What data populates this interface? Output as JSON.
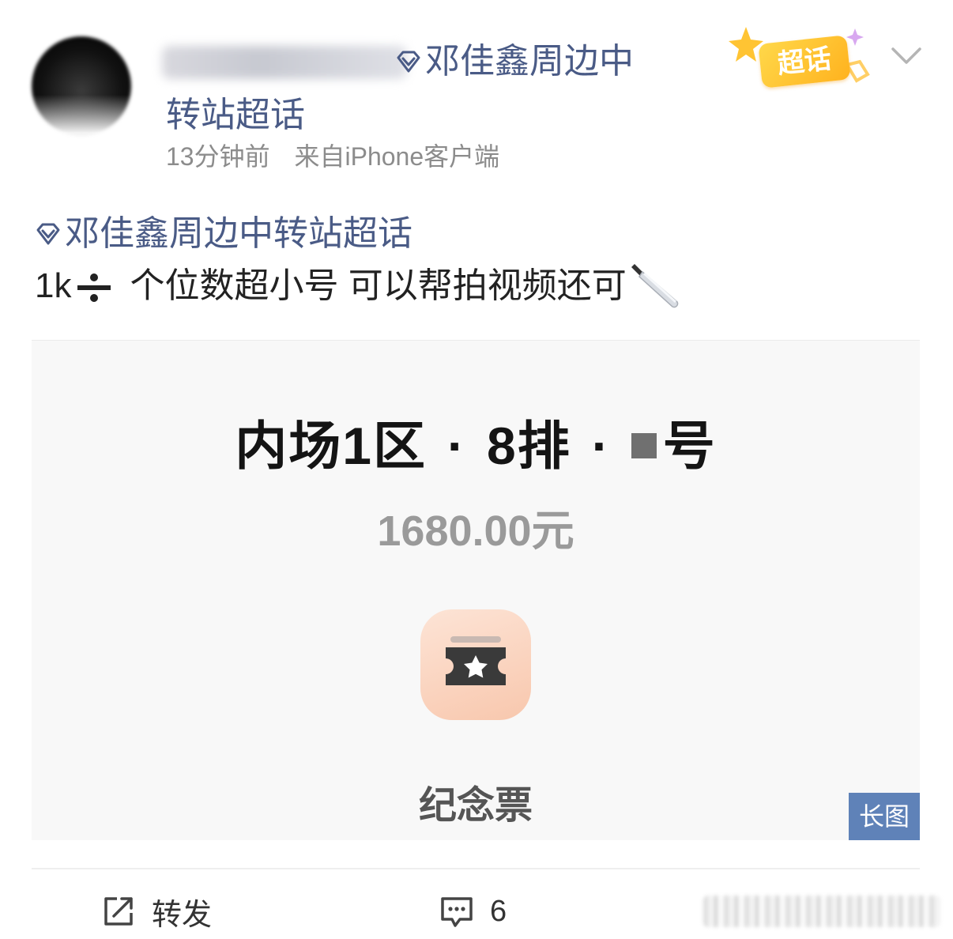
{
  "header": {
    "topic_line1": "邓佳鑫周边中",
    "topic_line2": "转站超话",
    "time": "13分钟前",
    "source": "来自iPhone客户端",
    "badge_label": "超话"
  },
  "post": {
    "topic_tag": "邓佳鑫周边中转站超话",
    "text_prefix": "1k",
    "text_main": "个位数超小号 可以帮拍视频还可"
  },
  "image": {
    "title_part1": "内场1区",
    "title_dot": "·",
    "title_part2": "8排",
    "title_part3": "号",
    "price": "1680.00元",
    "souvenir_label": "纪念票",
    "long_image_label": "长图"
  },
  "actions": {
    "repost_label": "转发",
    "comment_count": "6"
  },
  "colors": {
    "link": "#4a5b86",
    "meta": "#8c8c8c",
    "long_image_badge": "#5f82b8",
    "badge_gold": "#ffc433"
  }
}
